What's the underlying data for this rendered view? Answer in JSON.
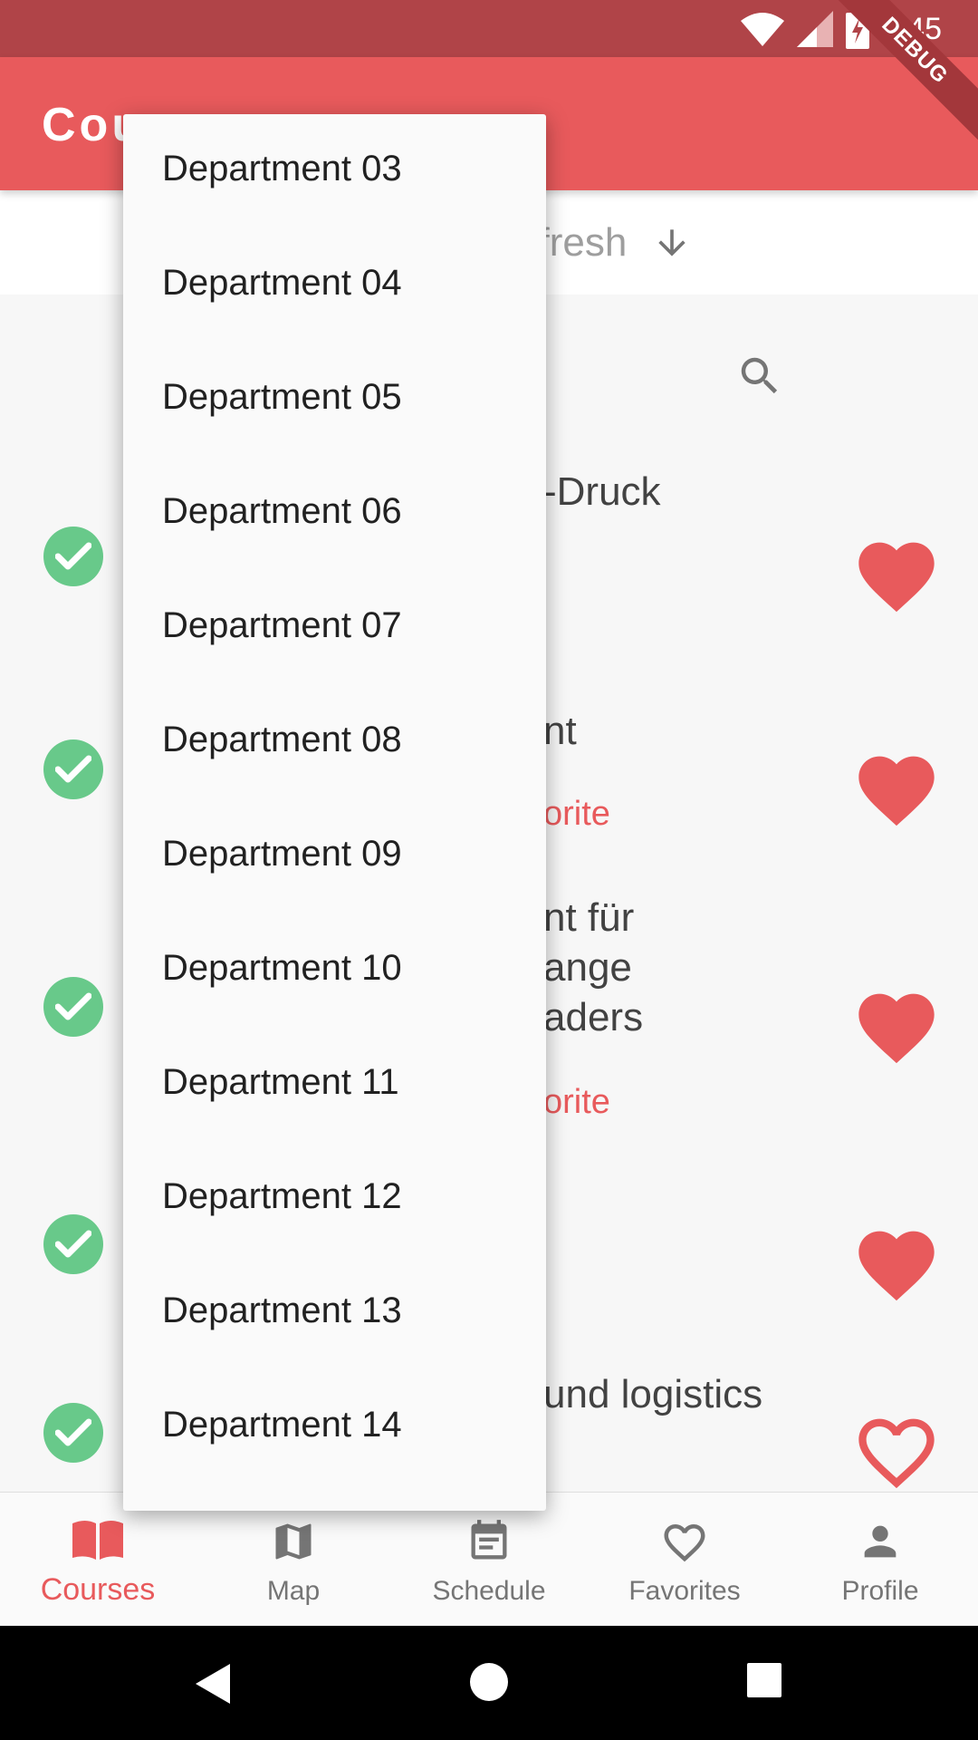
{
  "status_bar": {
    "time": "9:45",
    "debug_label": "DEBUG",
    "icons": [
      "wifi-icon",
      "signal-icon",
      "battery-charging-icon"
    ]
  },
  "app_bar": {
    "title": "Cou"
  },
  "refresh": {
    "label": "efresh",
    "icon": "arrow-down-icon"
  },
  "background_list": {
    "search_icon": "search-icon",
    "rows": [
      {
        "text": "-Druck",
        "favorite": true
      },
      {
        "text": "nt",
        "subtext": "orite",
        "favorite": true
      },
      {
        "text_lines": [
          "nt für",
          "ange",
          "aders"
        ],
        "subtext": "orite",
        "favorite": true
      },
      {
        "favorite": true
      },
      {
        "text": "und logistics",
        "favorite": false
      }
    ]
  },
  "dropdown": {
    "items": [
      "Department 03",
      "Department 04",
      "Department 05",
      "Department 06",
      "Department 07",
      "Department 08",
      "Department 09",
      "Department 10",
      "Department 11",
      "Department 12",
      "Department 13",
      "Department 14"
    ]
  },
  "bottom_nav": {
    "items": [
      {
        "label": "Courses",
        "icon": "book-open-icon",
        "active": true
      },
      {
        "label": "Map",
        "icon": "map-icon",
        "active": false
      },
      {
        "label": "Schedule",
        "icon": "calendar-icon",
        "active": false
      },
      {
        "label": "Favorites",
        "icon": "heart-outline-icon",
        "active": false
      },
      {
        "label": "Profile",
        "icon": "person-icon",
        "active": false
      }
    ]
  },
  "colors": {
    "primary": "#E85A5C",
    "status_bar": "#B04448",
    "check_green": "#68C98A"
  }
}
